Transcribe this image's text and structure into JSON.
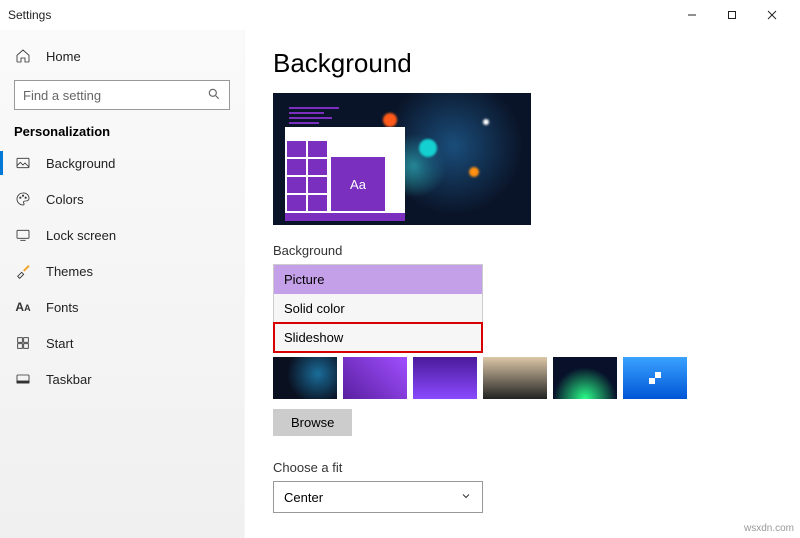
{
  "window": {
    "title": "Settings"
  },
  "sidebar": {
    "home_label": "Home",
    "search_placeholder": "Find a setting",
    "category_label": "Personalization",
    "items": [
      {
        "label": "Background"
      },
      {
        "label": "Colors"
      },
      {
        "label": "Lock screen"
      },
      {
        "label": "Themes"
      },
      {
        "label": "Fonts"
      },
      {
        "label": "Start"
      },
      {
        "label": "Taskbar"
      }
    ]
  },
  "main": {
    "page_title": "Background",
    "preview_tile_text": "Aa",
    "background_label": "Background",
    "options": [
      {
        "label": "Picture"
      },
      {
        "label": "Solid color"
      },
      {
        "label": "Slideshow"
      }
    ],
    "browse_label": "Browse",
    "fit_label": "Choose a fit",
    "fit_value": "Center"
  },
  "watermark": "wsxdn.com"
}
